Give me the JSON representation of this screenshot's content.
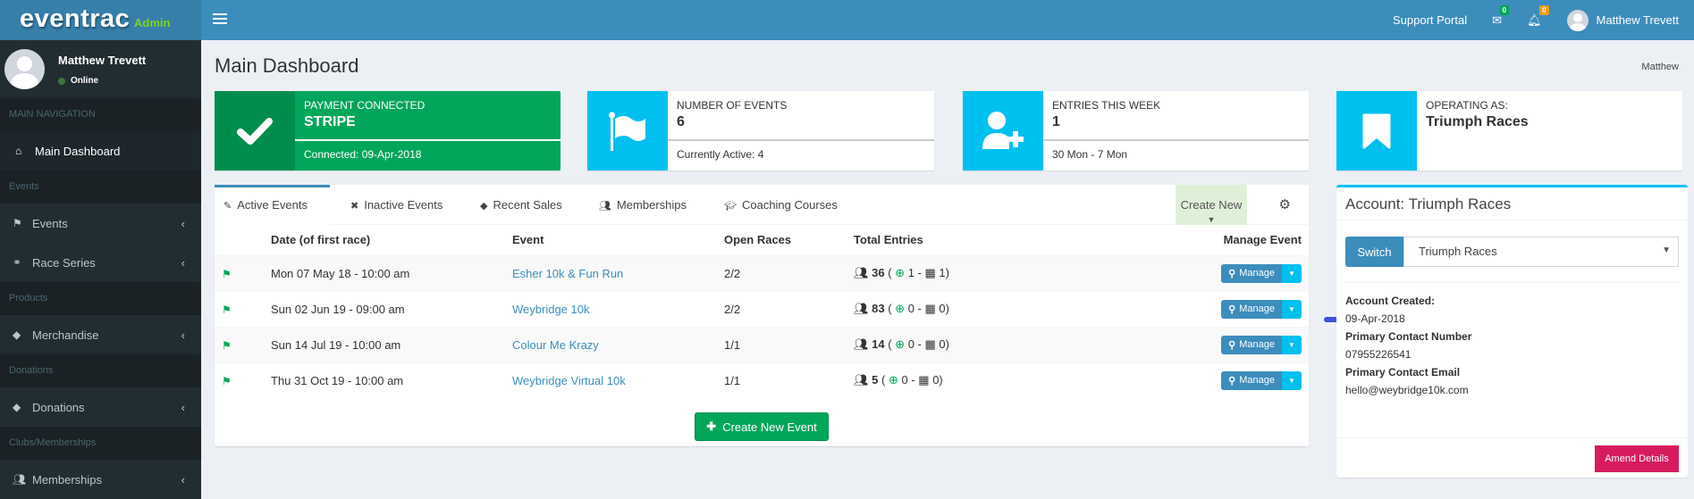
{
  "app": {
    "brand": "eventrac",
    "brand_suffix": "Admin"
  },
  "topnav": {
    "support": "Support Portal",
    "messages_count": "0",
    "notifications_count": "0",
    "user": "Matthew Trevett",
    "colors": {
      "messages_badge": "#00a65a",
      "notifications_badge": "#f39c12"
    }
  },
  "sidebar": {
    "user_name": "Matthew Trevett",
    "status": "Online",
    "sections": [
      {
        "header": "MAIN NAVIGATION",
        "items": [
          {
            "label": "Main Dashboard",
            "icon": "home-icon"
          }
        ]
      },
      {
        "header": "Events",
        "items": [
          {
            "label": "Events",
            "icon": "flag-icon"
          },
          {
            "label": "Race Series",
            "icon": "link-icon"
          }
        ]
      },
      {
        "header": "Products",
        "items": [
          {
            "label": "Merchandise",
            "icon": "tags-icon"
          }
        ]
      },
      {
        "header": "Donations",
        "items": [
          {
            "label": "Donations",
            "icon": "tags-icon"
          }
        ]
      },
      {
        "header": "Clubs/Memberships",
        "items": [
          {
            "label": "Memberships",
            "icon": "users-icon"
          }
        ]
      }
    ]
  },
  "page": {
    "title": "Main Dashboard",
    "breadcrumb": "Matthew"
  },
  "info_boxes": [
    {
      "label": "PAYMENT CONNECTED",
      "value": "STRIPE",
      "desc": "Connected: 09-Apr-2018",
      "icon": "check-icon"
    },
    {
      "label": "NUMBER OF EVENTS",
      "value": "6",
      "desc": "Currently Active: 4",
      "icon": "flag-icon"
    },
    {
      "label": "ENTRIES THIS WEEK",
      "value": "1",
      "desc": "30 Mon - 7 Mon",
      "icon": "user-plus-icon"
    },
    {
      "label": "OPERATING AS:",
      "value": "Triumph Races",
      "desc": "",
      "icon": "bookmark-icon"
    }
  ],
  "tabs": [
    {
      "label": "Active Events",
      "icon": "ticket-icon",
      "active": true
    },
    {
      "label": "Inactive Events",
      "icon": "x-icon"
    },
    {
      "label": "Recent Sales",
      "icon": "tags-icon"
    },
    {
      "label": "Memberships",
      "icon": "users-icon"
    },
    {
      "label": "Coaching Courses",
      "icon": "graduation-cap-icon"
    }
  ],
  "create_new": "Create New",
  "table": {
    "headers": [
      "Date (of first race)",
      "Event",
      "Open Races",
      "Total Entries",
      "Manage Event"
    ],
    "rows": [
      {
        "date": "Mon 07 May 18 - 10:00 am",
        "event": "Esher 10k & Fun Run",
        "open": "2/2",
        "total": "36",
        "up": "1",
        "cal": "1"
      },
      {
        "date": "Sun 02 Jun 19 - 09:00 am",
        "event": "Weybridge 10k",
        "open": "2/2",
        "total": "83",
        "up": "0",
        "cal": "0"
      },
      {
        "date": "Sun 14 Jul 19 - 10:00 am",
        "event": "Colour Me Krazy",
        "open": "1/1",
        "total": "14",
        "up": "0",
        "cal": "0"
      },
      {
        "date": "Thu 31 Oct 19 - 10:00 am",
        "event": "Weybridge Virtual 10k",
        "open": "1/1",
        "total": "5",
        "up": "0",
        "cal": "0"
      }
    ],
    "manage_label": "Manage"
  },
  "create_event": "Create New Event",
  "account": {
    "title": "Account: Triumph Races",
    "switch_label": "Switch",
    "selected": "Triumph Races",
    "created_label": "Account Created:",
    "created": "09-Apr-2018",
    "phone_label": "Primary Contact Number",
    "phone": "07955226541",
    "email_label": "Primary Contact Email",
    "email": "hello@weybridge10k.com",
    "amend": "Amend Details"
  }
}
